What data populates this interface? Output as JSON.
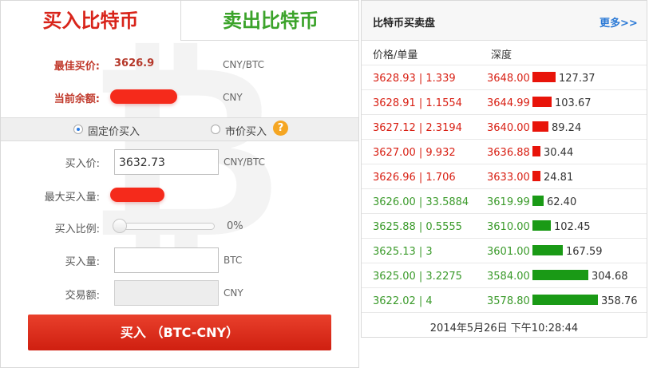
{
  "tabs": {
    "buy": "买入比特币",
    "sell": "卖出比特币"
  },
  "buy_form": {
    "best_price_label": "最佳买价:",
    "best_price_value": "3626.9",
    "best_price_unit": "CNY/BTC",
    "balance_label": "当前余额:",
    "balance_unit": "CNY",
    "mode_fixed": "固定价买入",
    "mode_market": "市价买入",
    "help_icon_glyph": "?",
    "price_label": "买入价:",
    "price_value": "3632.73",
    "price_unit": "CNY/BTC",
    "max_label": "最大买入量:",
    "ratio_label": "买入比例:",
    "ratio_value": "0%",
    "ratio_fraction": 0,
    "amount_label": "买入量:",
    "amount_unit": "BTC",
    "total_label": "交易额:",
    "total_unit": "CNY",
    "submit_label": "买入 （BTC-CNY）"
  },
  "order_book": {
    "title": "比特币买卖盘",
    "more_link": "更多>>",
    "col_price_qty": "价格/单量",
    "col_depth": "深度",
    "asks": [
      {
        "price_qty": "3628.93 | 1.339",
        "depth": "3648.00",
        "volume": "127.37",
        "volume_num": 127.37
      },
      {
        "price_qty": "3628.91 | 1.1554",
        "depth": "3644.99",
        "volume": "103.67",
        "volume_num": 103.67
      },
      {
        "price_qty": "3627.12 | 2.3194",
        "depth": "3640.00",
        "volume": "89.24",
        "volume_num": 89.24
      },
      {
        "price_qty": "3627.00 | 9.932",
        "depth": "3636.88",
        "volume": "30.44",
        "volume_num": 30.44
      },
      {
        "price_qty": "3626.96 | 1.706",
        "depth": "3633.00",
        "volume": "24.81",
        "volume_num": 24.81
      }
    ],
    "bids": [
      {
        "price_qty": "3626.00 | 33.5884",
        "depth": "3619.99",
        "volume": "62.40",
        "volume_num": 62.4
      },
      {
        "price_qty": "3625.88 | 0.5555",
        "depth": "3610.00",
        "volume": "102.45",
        "volume_num": 102.45
      },
      {
        "price_qty": "3625.13 | 3",
        "depth": "3601.00",
        "volume": "167.59",
        "volume_num": 167.59
      },
      {
        "price_qty": "3625.00 | 3.2275",
        "depth": "3584.00",
        "volume": "304.68",
        "volume_num": 304.68
      },
      {
        "price_qty": "3622.02 | 4",
        "depth": "3578.80",
        "volume": "358.76",
        "volume_num": 358.76
      }
    ],
    "timestamp": "2014年5月26日 下午10:28:44"
  },
  "colors": {
    "ask": "#d81e12",
    "bid": "#3a9a2a",
    "buy_button": "#d8241a",
    "link": "#2c7ad6"
  },
  "icons": {
    "watermark": "bitcoin-watermark-icon",
    "help": "help-question-icon"
  }
}
